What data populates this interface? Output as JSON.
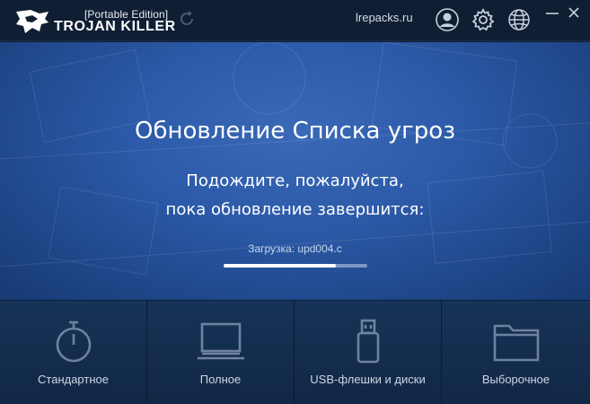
{
  "titlebar": {
    "edition": "[Portable Edition]",
    "brand": "TROJAN KILLER",
    "site": "lrepacks.ru",
    "icons": [
      "logo-icon",
      "refresh-icon",
      "user-icon",
      "gear-icon",
      "globe-icon",
      "minimize-icon",
      "close-icon"
    ]
  },
  "main": {
    "heading": "Обновление Списка угроз",
    "line1": "Подождите, пожалуйста,",
    "line2": "пока обновление завершится:",
    "progress_label": "Загрузка: upd004.c",
    "progress_fraction": 0.78
  },
  "tiles": [
    {
      "label": "Стандартное",
      "icon": "stopwatch-icon"
    },
    {
      "label": "Полное",
      "icon": "laptop-icon"
    },
    {
      "label": "USB-флешки и диски",
      "icon": "usb-icon"
    },
    {
      "label": "Выборочное",
      "icon": "folder-icon"
    }
  ],
  "colors": {
    "titlebar_bg": "#101e33",
    "main_bg": "#2c5aa8",
    "tiles_bg": "#132b4c",
    "tile_icon": "#6e829f"
  }
}
